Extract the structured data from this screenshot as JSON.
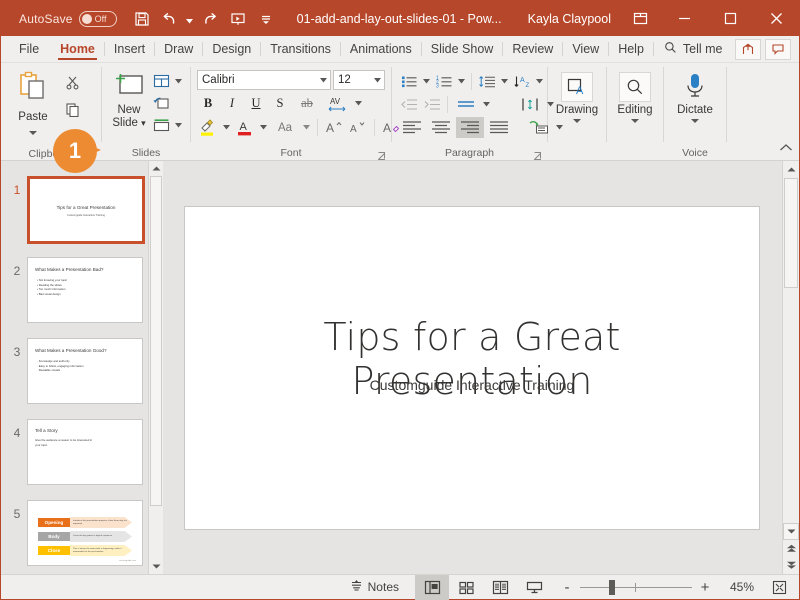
{
  "titlebar": {
    "autosave_label": "AutoSave",
    "autosave_state": "Off",
    "document_title": "01-add-and-lay-out-slides-01  -  Pow...",
    "user_name": "Kayla Claypool",
    "quick_access": [
      "save-icon",
      "undo-icon",
      "redo-icon",
      "start-presentation-icon",
      "customize-qat-icon"
    ],
    "window_controls": [
      "ribbon-display-options-icon",
      "minimize-icon",
      "maximize-icon",
      "close-icon"
    ],
    "brand_color": "#b7472a"
  },
  "tabs": [
    {
      "label": "File"
    },
    {
      "label": "Home"
    },
    {
      "label": "Insert"
    },
    {
      "label": "Draw"
    },
    {
      "label": "Design"
    },
    {
      "label": "Transitions"
    },
    {
      "label": "Animations"
    },
    {
      "label": "Slide Show"
    },
    {
      "label": "Review"
    },
    {
      "label": "View"
    },
    {
      "label": "Help"
    }
  ],
  "active_tab": "Home",
  "tellme": {
    "label": "Tell me",
    "icon": "search-icon"
  },
  "tab_right_buttons": [
    "share-icon",
    "comments-icon"
  ],
  "callout": {
    "number": "1",
    "color": "#ed8b33"
  },
  "ribbon": {
    "groups": [
      {
        "name": "Clipboard",
        "label": "Clipboard",
        "paste_label": "Paste",
        "items": [
          "paste-icon",
          "cut-icon",
          "copy-icon",
          "format-painter-icon"
        ]
      },
      {
        "name": "Slides",
        "label": "Slides",
        "new_slide_label_line1": "New",
        "new_slide_label_line2": "Slide",
        "items": [
          "new-slide-icon",
          "layout-icon",
          "reset-icon",
          "section-icon"
        ]
      },
      {
        "name": "Font",
        "label": "Font",
        "font_name": "Calibri",
        "font_size": "12",
        "items": [
          "bold-icon",
          "italic-icon",
          "underline-icon",
          "text-shadow-icon",
          "strikethrough-icon",
          "character-spacing-icon",
          "text-highlight-icon",
          "font-color-icon",
          "change-case-icon",
          "increase-font-size-icon",
          "decrease-font-size-icon",
          "clear-formatting-icon"
        ]
      },
      {
        "name": "Paragraph",
        "label": "Paragraph",
        "items": [
          "bullets-icon",
          "numbering-icon",
          "line-spacing-icon",
          "text-direction-icon",
          "decrease-indent-icon",
          "increase-indent-icon",
          "align-text-icon",
          "align-left-icon",
          "align-center-icon",
          "align-right-icon",
          "justify-icon",
          "convert-to-smartart-icon"
        ],
        "selected_item": "align-center-icon"
      },
      {
        "name": "Drawing",
        "label": "",
        "button_label": "Drawing",
        "icon": "drawing-icon"
      },
      {
        "name": "Editing",
        "label": "",
        "button_label": "Editing",
        "icon": "editing-search-icon"
      },
      {
        "name": "Voice",
        "label": "Voice",
        "button_label": "Dictate",
        "icon": "microphone-icon"
      }
    ],
    "collapse_icon": "collapse-ribbon-icon"
  },
  "thumbnails": {
    "selected": 1,
    "slides": [
      {
        "number": "1",
        "type": "title",
        "title": "Tips for a Great Presentation",
        "subtitle": "Customguide Interactive Training"
      },
      {
        "number": "2",
        "type": "bullets",
        "title": "What Makes a Presentation Bad?",
        "bullets": [
          "Not knowing your topic",
          "Reading the slides",
          "Too much information",
          "Bad visual design"
        ]
      },
      {
        "number": "3",
        "type": "bullets",
        "title": "What Makes a Presentation Good?",
        "bullets": [
          "Knowledge and authority",
          "Easy to follow, engaging information",
          "Readable visuals"
        ]
      },
      {
        "number": "4",
        "type": "text",
        "title": "Tell a Story",
        "body": "Give the audience a reason to be interested in your topic."
      },
      {
        "number": "5",
        "type": "diagram",
        "rows": [
          {
            "label": "Opening",
            "chip_color": "#e8701a",
            "arrow_color": "#fbe2cc",
            "text": "Introduce the presentation purpose; show them why it is important"
          },
          {
            "label": "Body",
            "chip_color": "#a6a6a6",
            "arrow_color": "#e5e5e5",
            "text": "Cover the key points in logical sequence"
          },
          {
            "label": "Close",
            "chip_color": "#ffc000",
            "arrow_color": "#fff0c2",
            "text": "This is where the main point is happening; make it memorable for the presentation"
          }
        ],
        "footer": "customguide.com"
      }
    ]
  },
  "slide": {
    "title": "Tips for a Great Presentation",
    "subtitle": "Customguide Interactive Training"
  },
  "statusbar": {
    "notes_label": "Notes",
    "notes_icon": "notes-icon",
    "views": [
      {
        "name": "normal-view",
        "icon": "normal-view-icon",
        "active": true
      },
      {
        "name": "slide-sorter-view",
        "icon": "slide-sorter-icon",
        "active": false
      },
      {
        "name": "reading-view",
        "icon": "reading-view-icon",
        "active": false
      },
      {
        "name": "slide-show-view",
        "icon": "slide-show-icon",
        "active": false
      }
    ],
    "zoom_out_label": "-",
    "zoom_in_label": "+",
    "zoom_level": "45%",
    "fit_icon": "fit-slide-to-window-icon"
  }
}
